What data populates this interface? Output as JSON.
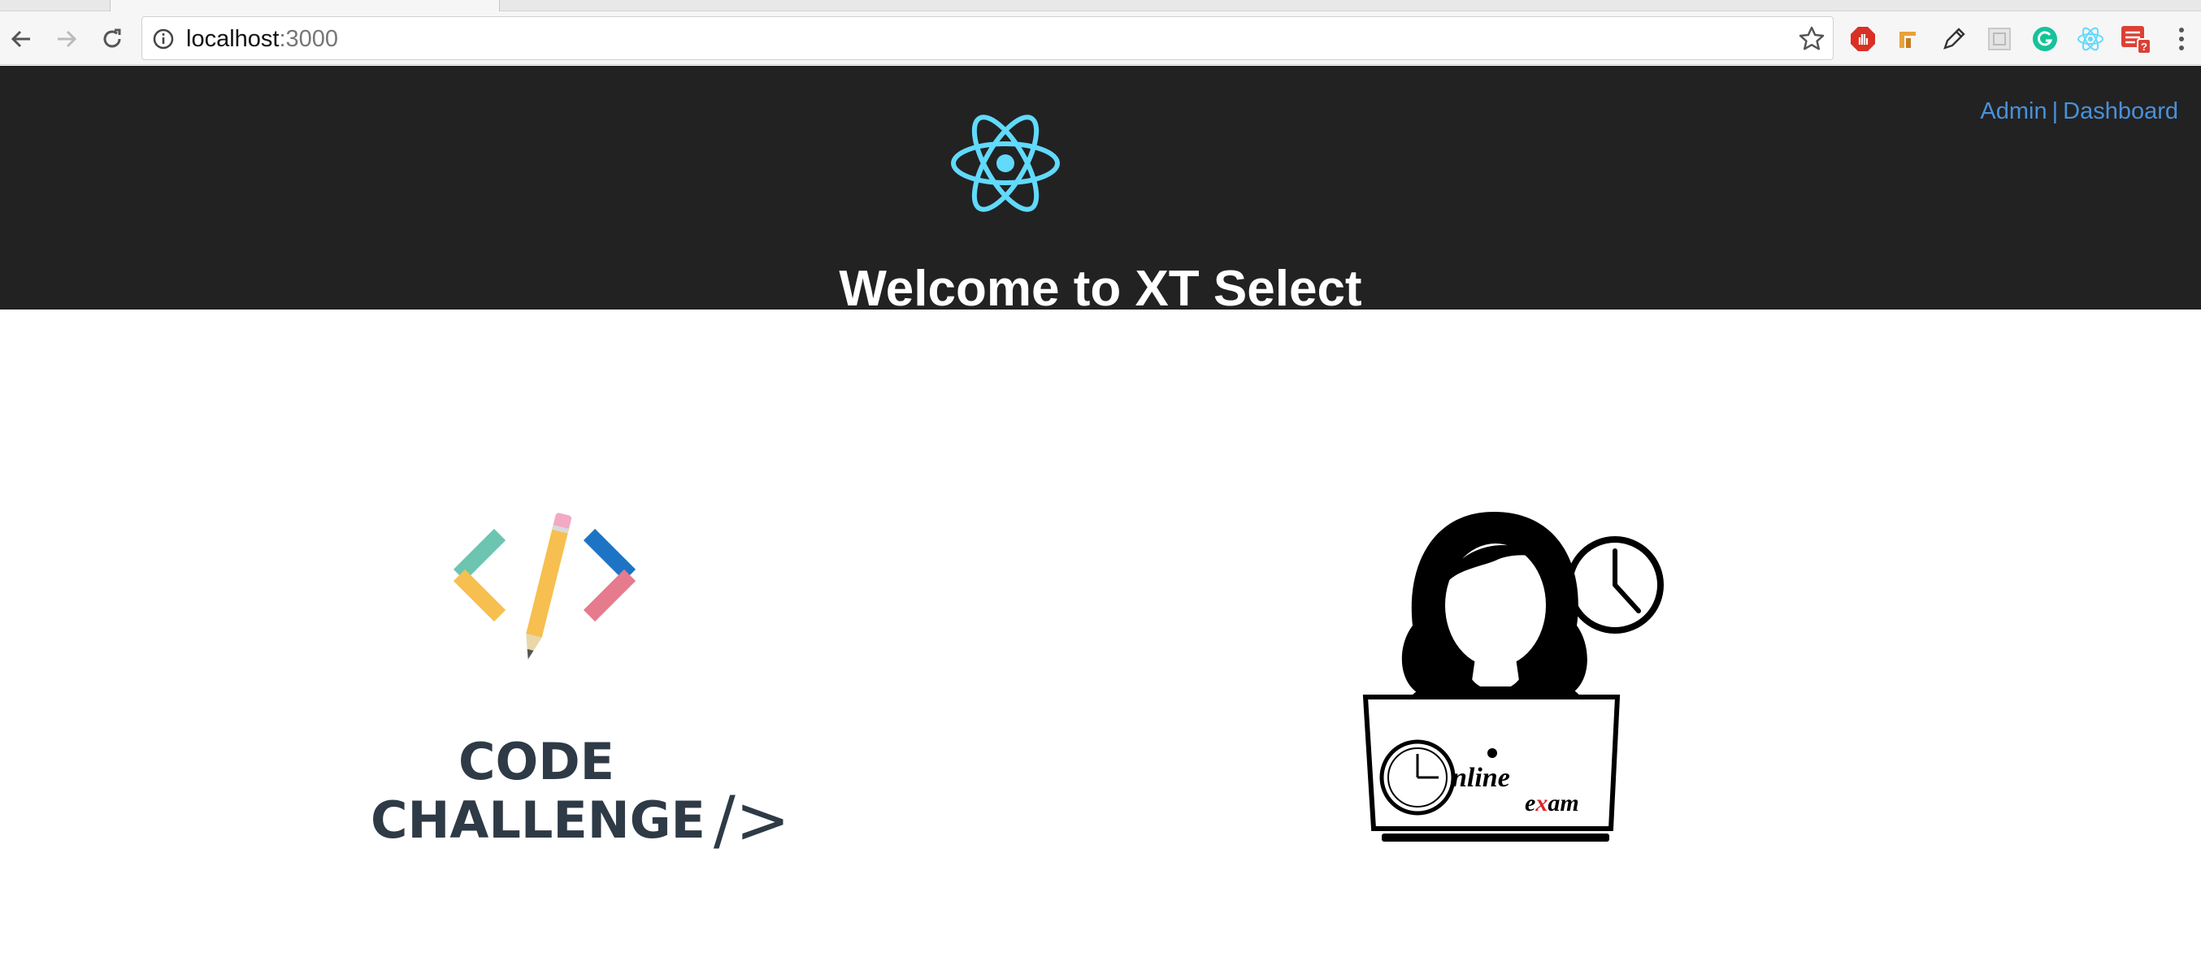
{
  "browser": {
    "url_host": "localhost",
    "url_port": ":3000",
    "nav_icons": [
      "back-arrow-icon",
      "forward-arrow-icon",
      "reload-icon"
    ],
    "extension_icons": [
      "adblock-icon",
      "extension-icon",
      "pencil-icon",
      "extension-grid-icon",
      "grammarly-icon",
      "react-devtools-icon",
      "todoist-icon",
      "menu-kebab-icon"
    ]
  },
  "header": {
    "title": "Welcome to XT Select",
    "nav": {
      "admin_label": "Admin",
      "separator": "|",
      "dashboard_label": "Dashboard"
    },
    "logo_icon": "react-logo-icon",
    "background": "#222222",
    "link_color": "#4a90d9",
    "logo_color": "#61dafb"
  },
  "cards": {
    "code_challenge": {
      "line1": "CODE",
      "line2": "CHALLENGE",
      "glyph": "/>"
    },
    "online_exam": {
      "word1": "nline",
      "word2_pre": "e",
      "word2_x": "x",
      "word2_post": "am"
    }
  }
}
